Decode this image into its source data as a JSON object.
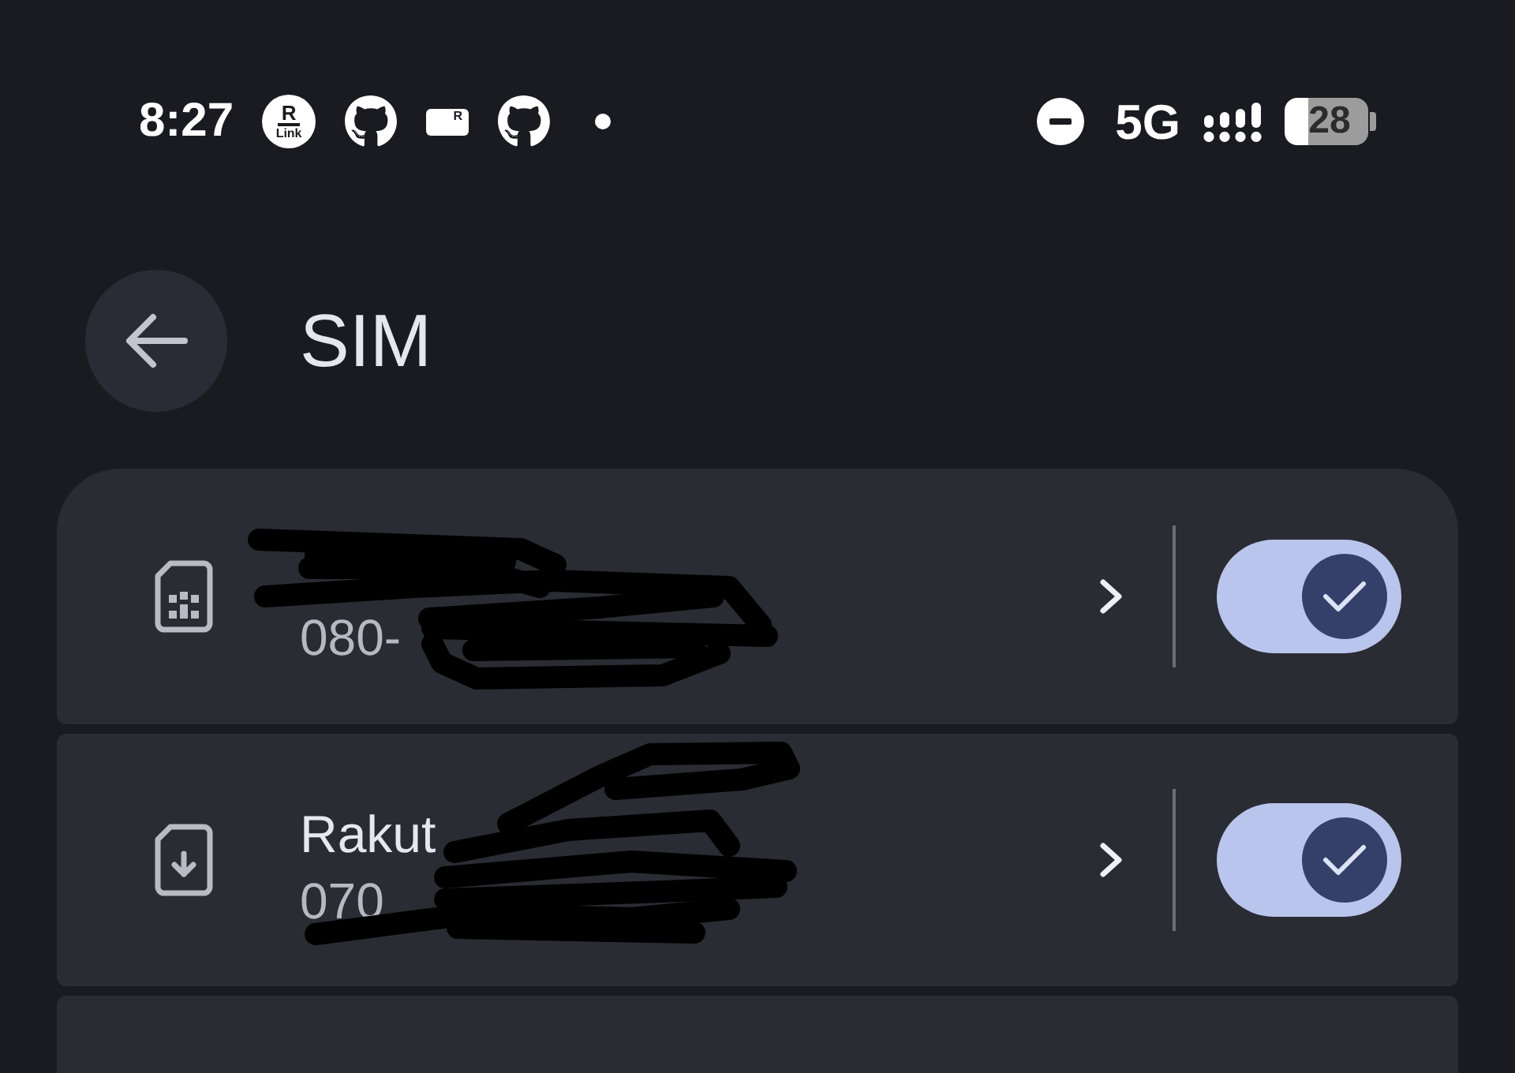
{
  "status_bar": {
    "time": "8:27",
    "notification_icons": [
      {
        "kind": "rakuten-link",
        "letter": "R",
        "caption": "Link"
      },
      {
        "kind": "octocat"
      },
      {
        "kind": "card",
        "letter": "R"
      },
      {
        "kind": "octocat"
      },
      {
        "kind": "dot"
      }
    ],
    "do_not_disturb": true,
    "network": "5G",
    "battery": "28"
  },
  "header": {
    "title": "SIM"
  },
  "sims": [
    {
      "kind": "physical",
      "number": "080-",
      "redacted": true,
      "on": true
    },
    {
      "kind": "esim",
      "name": "Rakut",
      "number": "070",
      "redacted": true,
      "on": true
    }
  ]
}
